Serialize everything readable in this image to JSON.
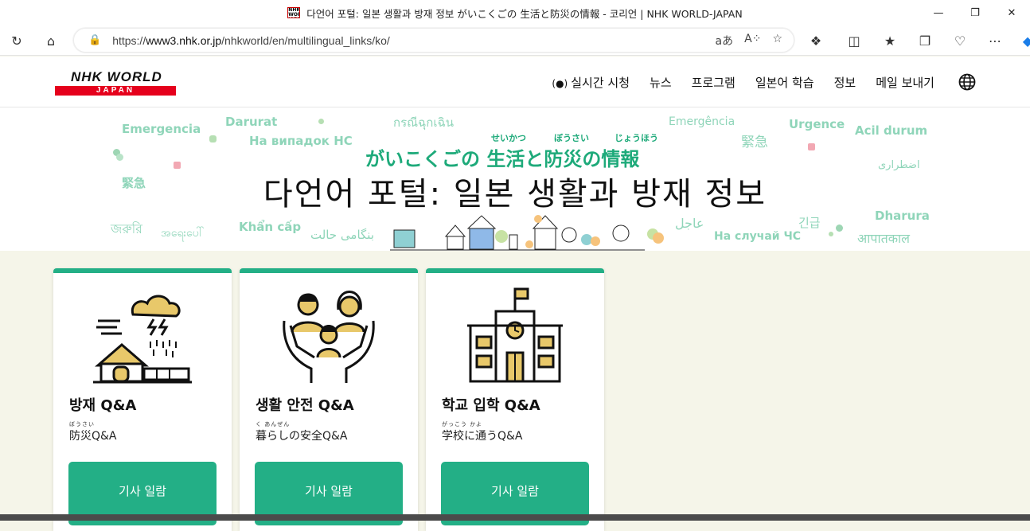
{
  "window": {
    "title": "다언어 포털: 일본 생활과 방재 정보   がいこくごの 生活と防災の情報 - 코리언 | NHK WORLD-JAPAN",
    "favicon_text": "NHK WORLD JAPAN"
  },
  "browser": {
    "url_prefix": "https://",
    "url_host": "www3.nhk.or.jp",
    "url_path": "/nhkworld/en/multilingual_links/ko/"
  },
  "header": {
    "logo_top": "NHK WORLD",
    "logo_bottom": "JAPAN",
    "nav": [
      {
        "label": "실시간 시청",
        "icon": "live-broadcast-icon"
      },
      {
        "label": "뉴스"
      },
      {
        "label": "프로그램"
      },
      {
        "label": "일본어 학습"
      },
      {
        "label": "정보"
      },
      {
        "label": "메일 보내기"
      }
    ],
    "language_icon": "globe-icon"
  },
  "hero": {
    "subtitle": "がいこくごの 生活と防災の情報",
    "subtitle_ruby": [
      "せいかつ",
      "ぼうさい",
      "じょうほう"
    ],
    "title": "다언어 포털: 일본 생활과 방재 정보",
    "words": [
      "Emergencia",
      "Darurat",
      "กรณีฉุกเฉิน",
      "Emergência",
      "Urgence",
      "Acil durum",
      "На випадок НС",
      "緊急",
      "緊急",
      "اضطراری",
      "জরুরি",
      "အရေးပေါ်",
      "Khẩn cấp",
      "بنگامی حالت",
      "عاجل",
      "На случай ЧС",
      "긴급",
      "Dharura",
      "आपातकाल"
    ]
  },
  "cards": [
    {
      "title": "방재 Q&A",
      "ruby": "ぼうさい",
      "jp": "防災Q&A",
      "button": "기사 일람",
      "icon": "disaster-weather-house-icon"
    },
    {
      "title": "생활 안전 Q&A",
      "ruby": "く           あんぜん",
      "jp": "暮らしの安全Q&A",
      "button": "기사 일람",
      "icon": "family-hands-icon"
    },
    {
      "title": "학교 입학 Q&A",
      "ruby": "がっこう    かよ",
      "jp": "学校に通うQ&A",
      "button": "기사 일람",
      "icon": "school-building-icon"
    }
  ],
  "colors": {
    "accent": "#23af86",
    "brand_red": "#e5001c",
    "word_green": "#8fd5b9",
    "page_bg": "#f5f5e9"
  }
}
